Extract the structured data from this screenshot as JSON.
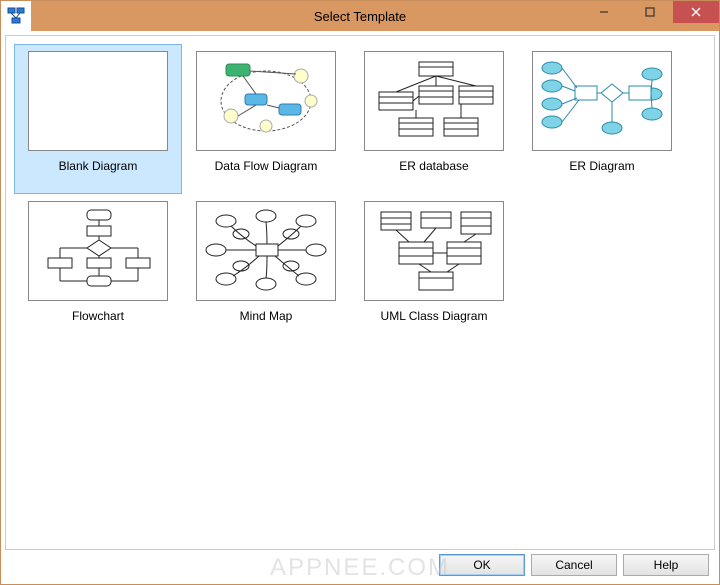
{
  "window": {
    "title": "Select Template"
  },
  "templates": [
    {
      "label": "Blank Diagram",
      "selected": true
    },
    {
      "label": "Data Flow Diagram",
      "selected": false
    },
    {
      "label": "ER database",
      "selected": false
    },
    {
      "label": "ER Diagram",
      "selected": false
    },
    {
      "label": "Flowchart",
      "selected": false
    },
    {
      "label": "Mind Map",
      "selected": false
    },
    {
      "label": "UML Class Diagram",
      "selected": false
    }
  ],
  "buttons": {
    "ok": "OK",
    "cancel": "Cancel",
    "help": "Help"
  },
  "watermark": "APPNEE.COM"
}
